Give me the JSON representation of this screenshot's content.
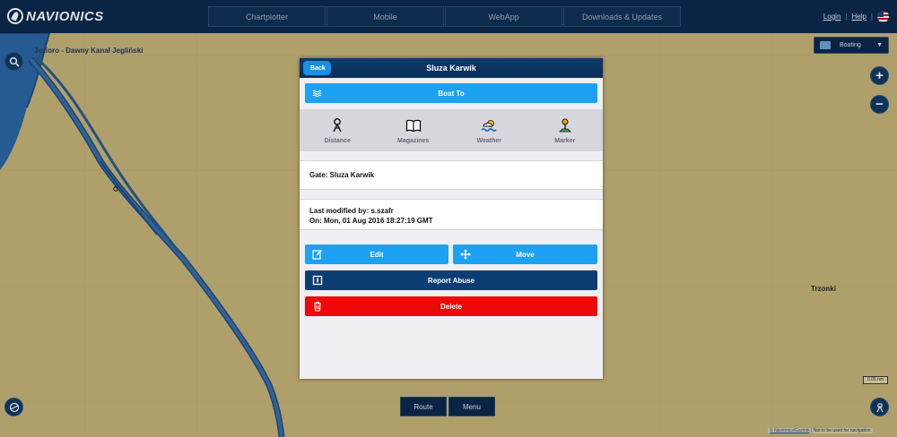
{
  "header": {
    "logo_text": "NAVIONICS",
    "nav_tabs": [
      "Chartplotter",
      "Mobile",
      "WebApp",
      "Downloads & Updates"
    ],
    "login": "Login",
    "help": "Help",
    "separator": "|"
  },
  "map": {
    "labels": {
      "lake": "Jezioro - Dawny Kanał Jegliński",
      "town": "Trzonki"
    },
    "layer_select": "Boating",
    "scale_text": "0.05 nm",
    "footer_link": "© Navionics/Garmin",
    "footer_text": "| Not to be used for navigation",
    "colors": {
      "land": "#c8b57a",
      "deep_water": "#2a5d92",
      "channel": "#3b6fa8",
      "lake": "#2b67a8"
    }
  },
  "bottom_bar": {
    "route": "Route",
    "menu": "Menu"
  },
  "modal": {
    "back_label": "Back",
    "title": "Sluza Karwik",
    "boat_to": "Boat To",
    "tools": [
      {
        "label": "Distance",
        "icon": "distance-icon"
      },
      {
        "label": "Magazines",
        "icon": "magazines-icon"
      },
      {
        "label": "Weather",
        "icon": "weather-icon"
      },
      {
        "label": "Marker",
        "icon": "marker-icon"
      }
    ],
    "gate_text": "Gate: Sluza Karwik",
    "modified_by": "Last modified by: s.szafr",
    "modified_on": "On: Mon, 01 Aug 2016 18:27:19 GMT",
    "edit": "Edit",
    "move": "Move",
    "report_abuse": "Report Abuse",
    "delete": "Delete",
    "colors": {
      "primary": "#1da1f2",
      "dark": "#0c3d73",
      "danger": "#f00808"
    }
  }
}
